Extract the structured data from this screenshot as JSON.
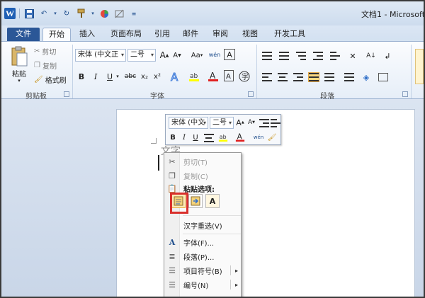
{
  "title_bar": {
    "title": "文档1 - Microsoft"
  },
  "tabs": [
    {
      "label": "文件"
    },
    {
      "label": "开始"
    },
    {
      "label": "插入"
    },
    {
      "label": "页面布局"
    },
    {
      "label": "引用"
    },
    {
      "label": "邮件"
    },
    {
      "label": "审阅"
    },
    {
      "label": "视图"
    },
    {
      "label": "开发工具"
    }
  ],
  "ribbon": {
    "clipboard": {
      "paste": "粘贴",
      "cut": "剪切",
      "copy": "复制",
      "format_painter": "格式刷",
      "group_label": "剪贴板"
    },
    "font": {
      "font_name": "宋体 (中文正",
      "font_size": "二号",
      "grow": "A",
      "shrink": "A",
      "case": "Aa",
      "phonetic": "wén",
      "border_char": "A",
      "bold": "B",
      "italic": "I",
      "underline": "U",
      "strike": "abc",
      "subscript": "x₂",
      "superscript": "x²",
      "group_label": "字体"
    },
    "paragraph": {
      "group_label": "段落"
    }
  },
  "mini_toolbar": {
    "font_name": "宋体 (中文",
    "font_size": "二号",
    "bold": "B",
    "italic": "I",
    "underline": "U"
  },
  "document": {
    "text": "文字"
  },
  "context_menu": {
    "items": [
      {
        "label": "剪切(T)"
      },
      {
        "label": "复制(C)"
      },
      {
        "label": "粘贴选项:"
      },
      {
        "label": "汉字重选(V)"
      },
      {
        "label": "字体(F)..."
      },
      {
        "label": "段落(P)..."
      },
      {
        "label": "项目符号(B)"
      },
      {
        "label": "编号(N)"
      }
    ],
    "paste_option_glyph": "A"
  },
  "colors": {
    "file_tab": "#2b5797",
    "highlight_box": "#d9302c",
    "ribbon_border": "#9db3d2"
  }
}
